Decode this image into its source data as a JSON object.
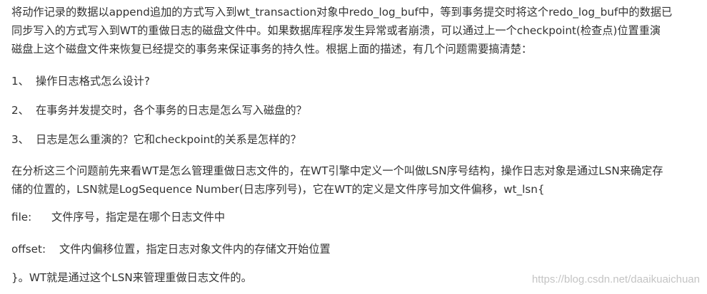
{
  "article": {
    "intro_lines": [
      "将动作记录的数据以append追加的方式写入到wt_transaction对象中redo_log_buf中，等到事务提交时将这个redo_log_buf中的数据已",
      "同步写入的方式写入到WT的重做日志的磁盘文件中。如果数据库程序发生异常或者崩溃，可以通过上一个checkpoint(检查点)位置重演",
      "磁盘上这个磁盘文件来恢复已经提交的事务来保证事务的持久性。根据上面的描述，有几个问题需要搞清楚："
    ],
    "questions": [
      {
        "num": "1、",
        "text": "操作日志格式怎么设计?"
      },
      {
        "num": "2、",
        "text": "在事务并发提交时，各个事务的日志是怎么写入磁盘的？"
      },
      {
        "num": "3、",
        "text": "日志是怎么重演的？它和checkpoint的关系是怎样的？"
      }
    ],
    "lsn_lines": [
      "在分析这三个问题前先来看WT是怎么管理重做日志文件的，在WT引擎中定义一个叫做LSN序号结构，操作日志对象是通过LSN来确定存",
      "储的位置的，LSN就是LogSequence Number(日志序列号)，它在WT的定义是文件序号加文件偏移，wt_lsn{"
    ],
    "fields": {
      "file": {
        "key": "file:",
        "desc": "文件序号，指定是在哪个日志文件中"
      },
      "offset": {
        "key": "offset:",
        "desc": "文件内偏移位置，指定日志对象文件内的存储文开始位置"
      }
    },
    "closing": "}。WT就是通过这个LSN来管理重做日志文件的。"
  },
  "watermark": "https://blog.csdn.net/daaikuaichuan",
  "colors": {
    "text": "#333333",
    "watermark": "#c4c4c4",
    "background": "#ffffff"
  }
}
